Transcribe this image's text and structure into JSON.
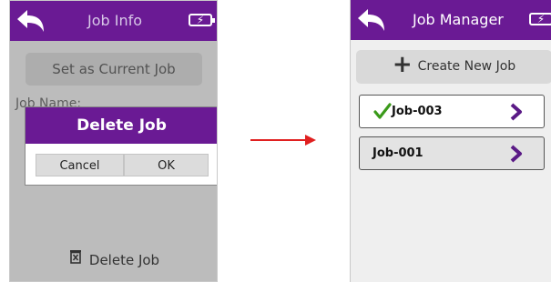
{
  "left_screen": {
    "header_title": "Job Info",
    "set_current_label": "Set as Current Job",
    "job_name_label": "Job Name:",
    "delete_job_label": "Delete Job",
    "dialog": {
      "title": "Delete Job",
      "cancel_label": "Cancel",
      "ok_label": "OK"
    }
  },
  "right_screen": {
    "header_title": "Job Manager",
    "create_label": "Create New Job",
    "jobs": [
      {
        "name": "Job-003",
        "current": true
      },
      {
        "name": "Job-001",
        "current": false
      }
    ]
  },
  "colors": {
    "header": "#6a1a94",
    "check": "#3a9a1a",
    "arrow": "#e02020"
  },
  "icons": [
    "back-arrow-icon",
    "battery-charging-icon",
    "trash-icon",
    "plus-icon",
    "check-icon",
    "chevron-right-icon",
    "transition-arrow-icon"
  ]
}
